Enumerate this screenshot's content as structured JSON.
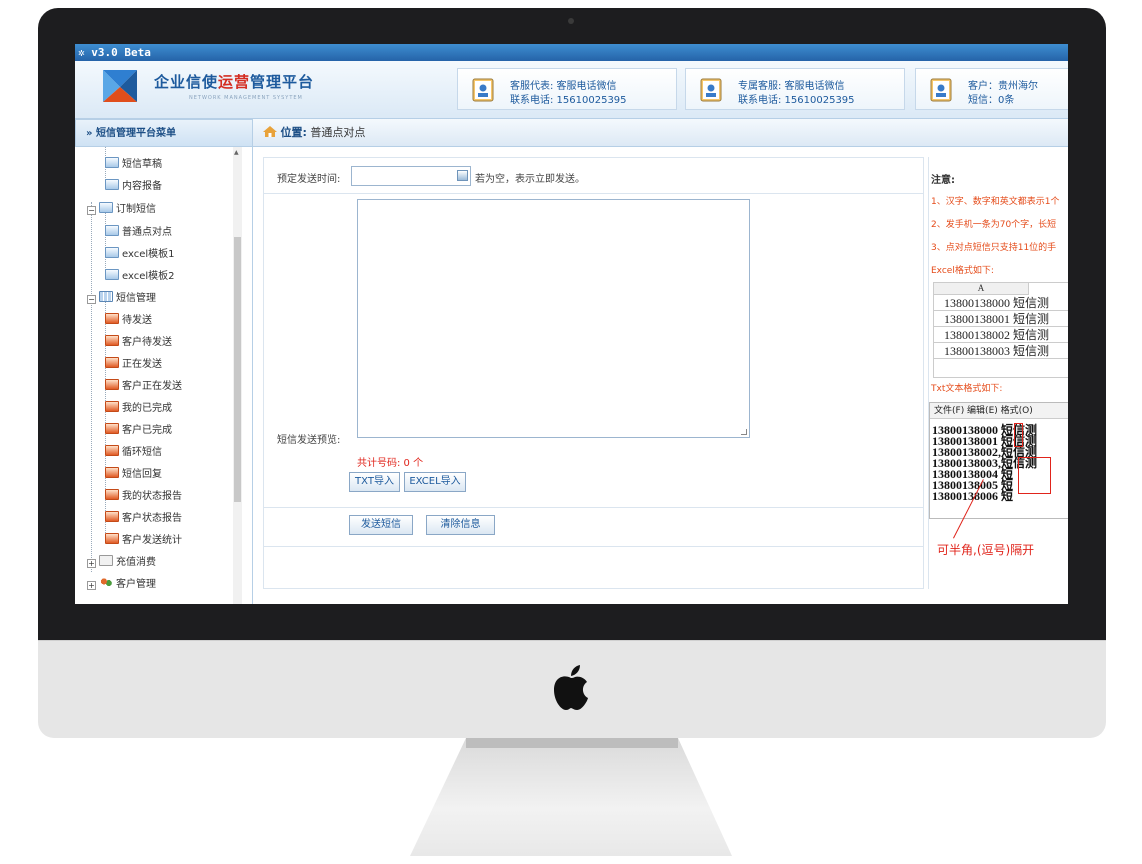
{
  "app": {
    "version_title": "v3.0 Beta",
    "brand_part1": "企业信使",
    "brand_part2": "运营",
    "brand_part3": "管理平台",
    "brand_sub": "NETWORK MANAGEMENT SYSYTEM"
  },
  "contacts": [
    {
      "line1": "客服代表: 客服电话微信",
      "line2": "联系电话: 15610025395"
    },
    {
      "line1": "专属客服: 客服电话微信",
      "line2": "联系电话: 15610025395"
    },
    {
      "line1": "客户：贵州海尔",
      "line2": "短信：0条"
    }
  ],
  "sidebar": {
    "header": "» 短信管理平台菜单",
    "items": [
      {
        "label": "短信草稿",
        "icon": "envelope-icon"
      },
      {
        "label": "内容报备",
        "icon": "envelope-icon"
      },
      {
        "label": "订制短信",
        "icon": "envelope-icon",
        "expander": "−"
      },
      {
        "label": "普通点对点",
        "icon": "envelope-icon"
      },
      {
        "label": "excel模板1",
        "icon": "envelope-icon"
      },
      {
        "label": "excel模板2",
        "icon": "envelope-icon"
      },
      {
        "label": "短信管理",
        "icon": "grid-icon",
        "expander": "−"
      },
      {
        "label": "待发送",
        "icon": "calendar-icon"
      },
      {
        "label": "客户待发送",
        "icon": "calendar-icon"
      },
      {
        "label": "正在发送",
        "icon": "calendar-icon"
      },
      {
        "label": "客户正在发送",
        "icon": "calendar-icon"
      },
      {
        "label": "我的已完成",
        "icon": "calendar-icon"
      },
      {
        "label": "客户已完成",
        "icon": "calendar-icon"
      },
      {
        "label": "循环短信",
        "icon": "calendar-icon"
      },
      {
        "label": "短信回复",
        "icon": "calendar-icon"
      },
      {
        "label": "我的状态报告",
        "icon": "calendar-icon"
      },
      {
        "label": "客户状态报告",
        "icon": "calendar-icon"
      },
      {
        "label": "客户发送统计",
        "icon": "calendar-icon"
      },
      {
        "label": "充值消费",
        "icon": "document-icon",
        "expander": "+"
      },
      {
        "label": "客户管理",
        "icon": "group-icon",
        "expander": "+"
      }
    ]
  },
  "breadcrumb": {
    "prefix": "位置:",
    "current": "普通点对点"
  },
  "form": {
    "schedule_label": "预定发送时间:",
    "schedule_value": "",
    "schedule_hint": "若为空，表示立即发送。",
    "preview_label": "短信发送预览:",
    "count_text": "共计号码: 0 个",
    "txt_import": "TXT导入",
    "excel_import": "EXCEL导入",
    "send": "发送短信",
    "clear": "清除信息"
  },
  "notes": {
    "title": "注意:",
    "lines": [
      "1、汉字、数字和英文都表示1个",
      "2、发手机一条为70个字，长短",
      "3、点对点短信只支持11位的手"
    ],
    "excel_caption": "Excel格式如下:",
    "excel_header": "A",
    "excel_rows": [
      "13800138000 短信测",
      "13800138001 短信测",
      "13800138002 短信测",
      "13800138003 短信测"
    ],
    "txt_caption": "Txt文本格式如下:",
    "txt_menu": "文件(F) 编辑(E) 格式(O)",
    "txt_rows": [
      "13800138000 短信测",
      "13800138001 短信测",
      "13800138002,短信测",
      "13800138003,短信测",
      "13800138004 短",
      "13800138005 短",
      "13800138006 短"
    ],
    "hint": "可半角,(逗号)隔开"
  }
}
